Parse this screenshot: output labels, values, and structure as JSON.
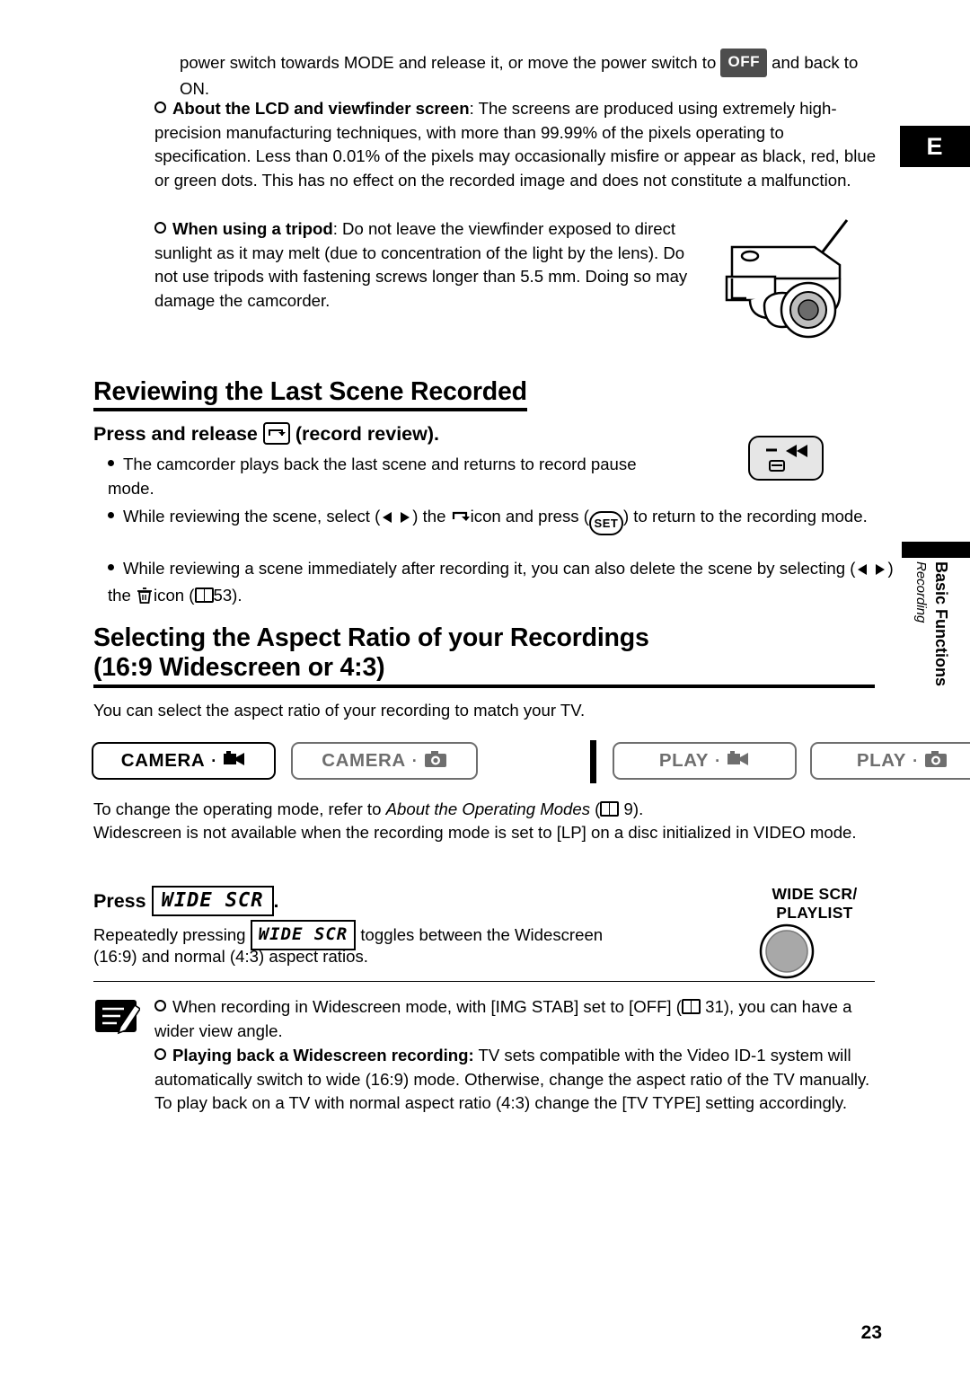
{
  "page": {
    "number": "23",
    "edge_tab": "E",
    "side_label_bold": "Basic Functions",
    "side_label_italic": "Recording"
  },
  "intro": {
    "line1_a": "power switch towards MODE and release it, or move the power switch to",
    "off_badge": "OFF",
    "line1_b": "and back to ON.",
    "bullet1_bold": "About the LCD and viewfinder screen",
    "bullet1_text": ": The screens are produced using extremely high-precision manufacturing techniques, with more than 99.99% of the pixels operating to specification. Less than 0.01% of the pixels may occasionally misfire or appear as black, red, blue or green dots. This has no effect on the recorded image and does not constitute a malfunction.",
    "bullet2_bold": "When using a tripod",
    "bullet2_text": ": Do not leave the viewfinder exposed to direct sunlight as it may melt (due to concentration of the light by the lens). Do not use tripods with fastening screws longer than 5.5 mm. Doing so may damage the camcorder."
  },
  "section1": {
    "heading": "Reviewing the Last Scene Recorded",
    "subheading_a": "Press and release",
    "subheading_key": "record-review-key",
    "subheading_b": "(record review).",
    "bullets": [
      "The camcorder plays back the last scene and returns to record pause mode.",
      "While reviewing the scene, select (    ) the      icon and press (      ) to return to the recording mode.",
      "While reviewing a scene immediately after recording it, you can also delete the scene by selecting (    ) the      icon (      53)."
    ],
    "bullet2_part1": "While reviewing the scene, select (",
    "bullet2_part2": ") the",
    "bullet2_part3": "icon and press (",
    "bullet2_part4": ") to return to the recording mode.",
    "bullet3_part1": "While reviewing a scene immediately after recording it, you can also delete the scene by selecting (",
    "bullet3_part2": ") the",
    "bullet3_part3": "icon (",
    "bullet3_part4": "53).",
    "set_label": "SET"
  },
  "section2": {
    "heading_line1": "Selecting the Aspect Ratio of your Recordings",
    "heading_line2": "(16:9 Widescreen or 4:3)",
    "intro": "You can select the aspect ratio of your recording to match your TV.",
    "modes": [
      {
        "label": "CAMERA",
        "icon": "movie-camera-icon",
        "state": "active"
      },
      {
        "label": "CAMERA",
        "icon": "still-photo-icon",
        "state": "dim"
      },
      {
        "label": "PLAY",
        "icon": "movie-camera-icon",
        "state": "dim"
      },
      {
        "label": "PLAY",
        "icon": "still-photo-icon",
        "state": "dim"
      }
    ],
    "modes_note_a": "To change the operating mode, refer to ",
    "modes_note_italic": "About the Operating Modes",
    "modes_note_b": " (",
    "modes_note_page": "9).",
    "modes_note_line2": "Widescreen is not available when the recording mode is set to [LP] on a disc initialized in VIDEO mode.",
    "press_label": "Press",
    "press_key": "WIDE SCR",
    "press_period": ".",
    "repeat_a": "Repeatedly pressing",
    "repeat_key": "WIDE SCR",
    "repeat_b": "toggles between the Widescreen",
    "repeat_line2": "(16:9) and normal (4:3) aspect ratios.",
    "button_label_line1": "WIDE SCR/",
    "button_label_line2": "PLAYLIST"
  },
  "notes": {
    "note1_a": "When recording in Widescreen mode, with [IMG STAB] set to [OFF] (",
    "note1_page": "31),",
    "note1_b": "you can have a wider view angle.",
    "note2_bold": "Playing back a Widescreen recording:",
    "note2_text": " TV sets compatible with the Video ID-1 system will automatically switch to wide (16:9) mode. Otherwise, change the aspect ratio of the TV manually. To play back on a TV with normal aspect ratio (4:3) change the [TV TYPE] setting accordingly."
  }
}
